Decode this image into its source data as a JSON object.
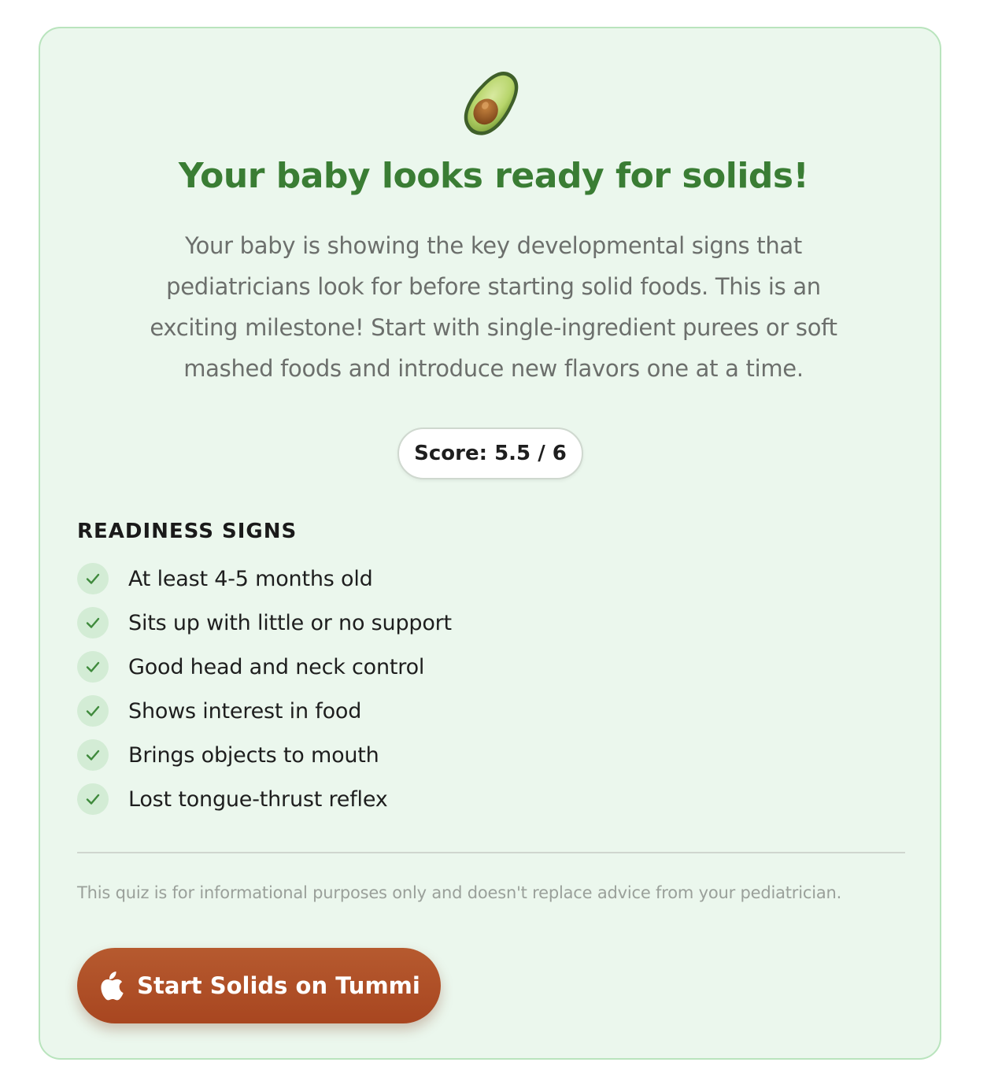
{
  "result": {
    "emoji_icon": "avocado-icon",
    "title": "Your baby looks ready for solids!",
    "description": "Your baby is showing the key developmental signs that pediatricians look for before starting solid foods. This is an exciting milestone! Start with single-ingredient purees or soft mashed foods and introduce new flavors one at a time.",
    "score_text": "Score: 5.5 / 6",
    "score": 5.5,
    "score_max": 6
  },
  "signs": {
    "heading": "READINESS SIGNS",
    "items": [
      {
        "label": "At least 4-5 months old",
        "checked": true
      },
      {
        "label": "Sits up with little or no support",
        "checked": true
      },
      {
        "label": "Good head and neck control",
        "checked": true
      },
      {
        "label": "Shows interest in food",
        "checked": true
      },
      {
        "label": "Brings objects to mouth",
        "checked": true
      },
      {
        "label": "Lost tongue-thrust reflex",
        "checked": true
      }
    ]
  },
  "disclaimer": "This quiz is for informational purposes only and doesn't replace advice from your pediatrician.",
  "cta": {
    "label": "Start Solids on Tummi",
    "icon": "apple-icon"
  },
  "colors": {
    "card_bg": "#ebf7ed",
    "card_border": "#b9e4bd",
    "title": "#3a7d34",
    "check_bg": "#d3ecd5",
    "check_mark": "#3f8a3c",
    "cta_bg": "#a84620"
  }
}
